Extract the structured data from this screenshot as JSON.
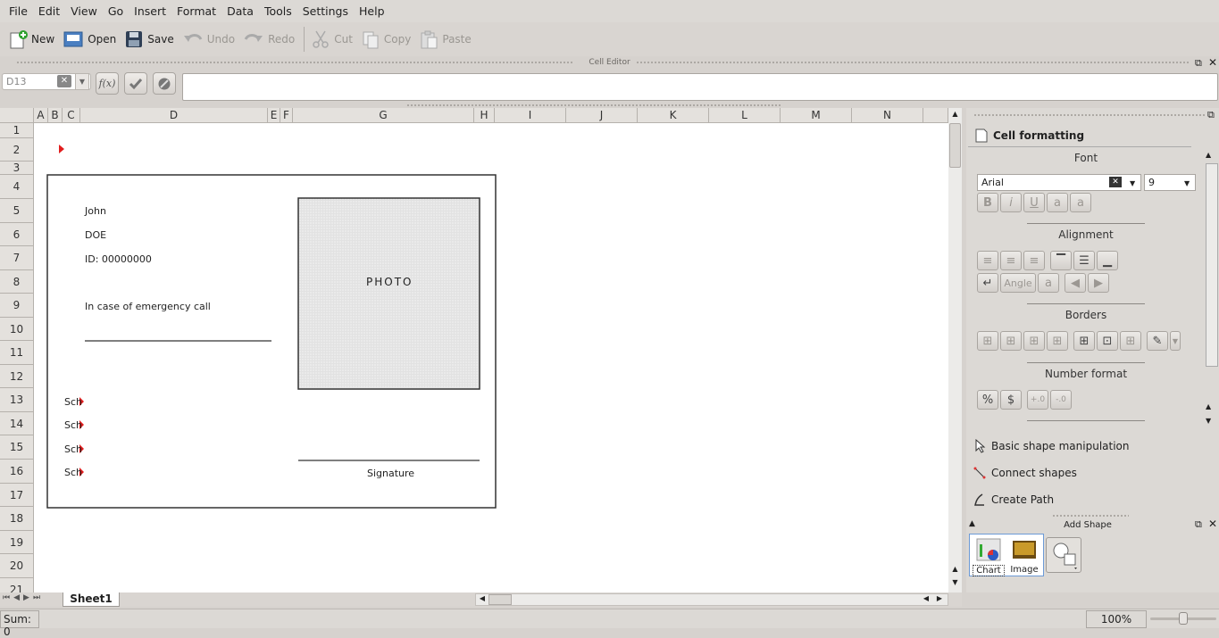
{
  "menu": [
    "File",
    "Edit",
    "View",
    "Go",
    "Insert",
    "Format",
    "Data",
    "Tools",
    "Settings",
    "Help"
  ],
  "toolbar": {
    "new": "New",
    "open": "Open",
    "save": "Save",
    "undo": "Undo",
    "redo": "Redo",
    "cut": "Cut",
    "copy": "Copy",
    "paste": "Paste"
  },
  "cell_editor": {
    "title": "Cell Editor",
    "cell_ref": "D13",
    "formula": ""
  },
  "columns": [
    "A",
    "B",
    "C",
    "D",
    "E",
    "F",
    "G",
    "H",
    "I",
    "J",
    "K",
    "L",
    "M",
    "N"
  ],
  "rows": [
    "1",
    "2",
    "3",
    "4",
    "5",
    "6",
    "7",
    "8",
    "9",
    "10",
    "11",
    "12",
    "13",
    "14",
    "15",
    "16",
    "17",
    "18",
    "19",
    "20",
    "21"
  ],
  "card": {
    "first_name": "John",
    "last_name": "DOE",
    "id": "ID: 00000000",
    "emergency": "In case of emergency call",
    "photo": "PHOTO",
    "signature": "Signature",
    "sch": [
      "Sch",
      "Sch",
      "Sch",
      "Sch"
    ]
  },
  "sheet_tab": "Sheet1",
  "status": {
    "sum": "Sum: 0",
    "zoom": "100%"
  },
  "panel": {
    "title": "Cell formatting",
    "font_label": "Font",
    "font_name": "Arial",
    "font_size": "9",
    "alignment_label": "Alignment",
    "angle_label": "Angle",
    "borders_label": "Borders",
    "number_format_label": "Number format",
    "tabs": [
      "Basic shape manipulation",
      "Connect shapes",
      "Create Path"
    ],
    "add_shape": "Add Shape",
    "chart": "Chart",
    "image": "Image"
  },
  "colors": {
    "accent_arrow": "#e11d1d",
    "photo_fill": "#e3e3e3"
  }
}
